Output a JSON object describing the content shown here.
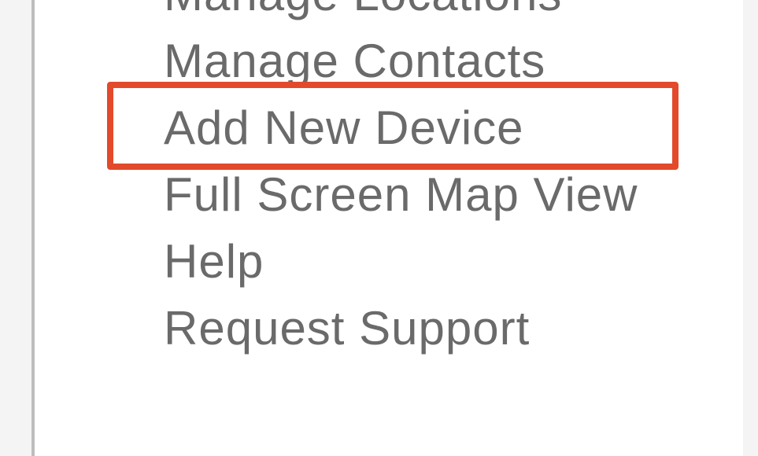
{
  "menu": {
    "items": [
      {
        "label": "Manage Locations"
      },
      {
        "label": "Manage Contacts"
      },
      {
        "label": "Add New Device"
      },
      {
        "label": "Full Screen Map View"
      },
      {
        "label": "Help"
      },
      {
        "label": "Request Support"
      }
    ],
    "highlighted_index": 2
  }
}
